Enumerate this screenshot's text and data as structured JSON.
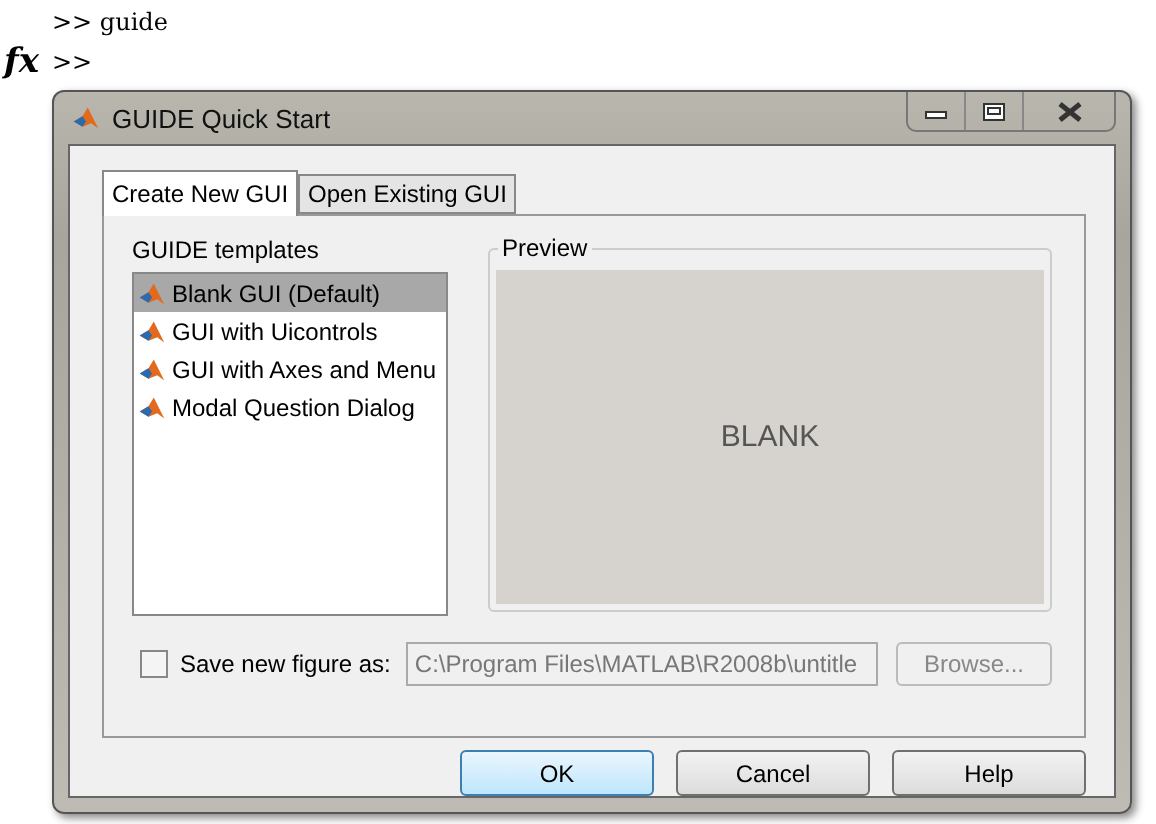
{
  "console": {
    "lines": [
      ">> guide"
    ],
    "prompt_symbol": "fx",
    "prompt": ">>"
  },
  "window": {
    "title": "GUIDE Quick Start"
  },
  "tabs": [
    {
      "label": "Create New GUI",
      "selected": true
    },
    {
      "label": "Open Existing GUI",
      "selected": false
    }
  ],
  "templates": {
    "label": "GUIDE templates",
    "items": [
      {
        "label": "Blank GUI (Default)",
        "selected": true
      },
      {
        "label": "GUI with Uicontrols",
        "selected": false
      },
      {
        "label": "GUI with Axes and Menu",
        "selected": false
      },
      {
        "label": "Modal Question Dialog",
        "selected": false
      }
    ]
  },
  "preview": {
    "label": "Preview",
    "text": "BLANK"
  },
  "save": {
    "label": "Save new figure as:",
    "checked": false,
    "value": "C:\\Program Files\\MATLAB\\R2008b\\untitle",
    "disabled": true,
    "browse": "Browse..."
  },
  "buttons": [
    {
      "label": "OK",
      "default": true
    },
    {
      "label": "Cancel",
      "default": false
    },
    {
      "label": "Help",
      "default": false
    }
  ]
}
